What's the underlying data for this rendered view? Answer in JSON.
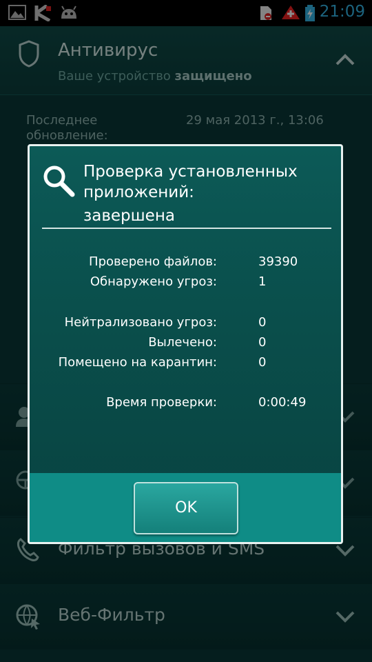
{
  "status_bar": {
    "time": "21:09"
  },
  "antivirus": {
    "title": "Антивирус",
    "subtitle_prefix": "Ваше устройство ",
    "subtitle_state": "защищено",
    "last_update_label": "Последнее обновление:",
    "last_update_value": "29 мая 2013 г., 13:06"
  },
  "rows": [
    {
      "label": "Фильтр вызовов и SMS"
    },
    {
      "label": "Веб-Фильтр"
    }
  ],
  "dialog": {
    "title": "Проверка установленных приложений:",
    "status": "завершена",
    "stats": {
      "files_checked_label": "Проверено файлов:",
      "files_checked_value": "39390",
      "threats_found_label": "Обнаружено угроз:",
      "threats_found_value": "1",
      "neutralized_label": "Нейтрализовано угроз:",
      "neutralized_value": "0",
      "cured_label": "Вылечено:",
      "cured_value": "0",
      "quarantined_label": "Помещено на карантин:",
      "quarantined_value": "0",
      "duration_label": "Время проверки:",
      "duration_value": "0:00:49"
    },
    "ok_label": "OK"
  }
}
